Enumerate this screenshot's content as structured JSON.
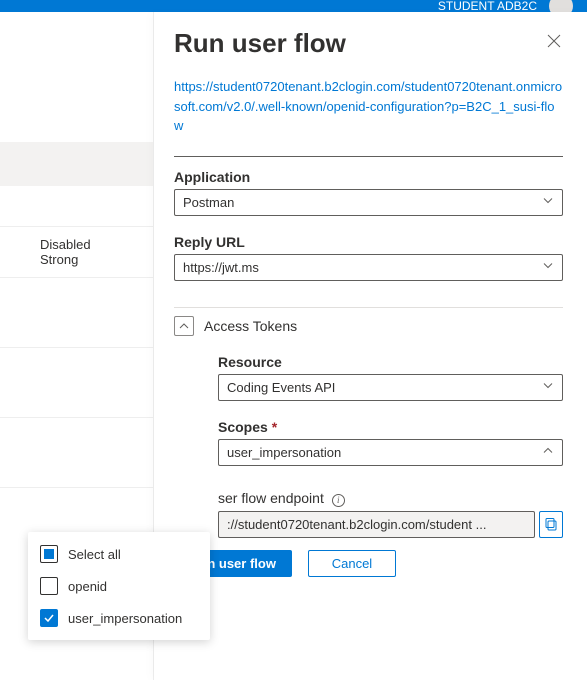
{
  "topbar": {
    "tenant_label": "STUDENT ADB2C"
  },
  "left": {
    "val1": "Disabled",
    "val2": "Strong"
  },
  "panel": {
    "title": "Run user flow",
    "metadata_url": "https://student0720tenant.b2clogin.com/student0720tenant.onmicrosoft.com/v2.0/.well-known/openid-configuration?p=B2C_1_susi-flow",
    "app_label": "Application",
    "app_value": "Postman",
    "reply_label": "Reply URL",
    "reply_value": "https://jwt.ms",
    "tokens_header": "Access Tokens",
    "resource_label": "Resource",
    "resource_value": "Coding Events API",
    "scopes_label": "Scopes",
    "scopes_value": "user_impersonation",
    "endpoint_label": "ser flow endpoint",
    "endpoint_value": "://student0720tenant.b2clogin.com/student ...",
    "run_label": "Run user flow",
    "cancel_label": "Cancel"
  },
  "popup": {
    "select_all": "Select all",
    "opt1": "openid",
    "opt2": "user_impersonation"
  }
}
